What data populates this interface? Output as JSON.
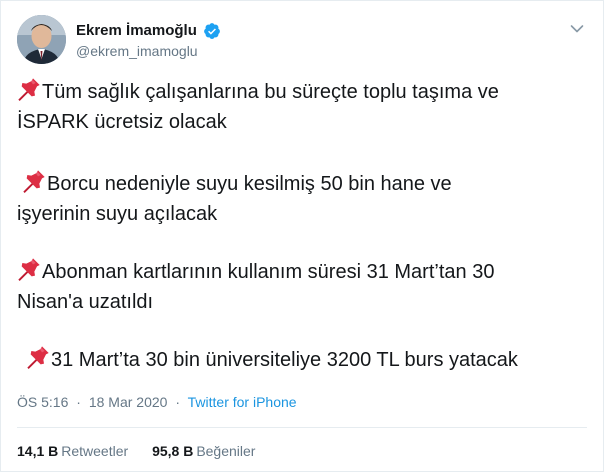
{
  "tweet": {
    "author": {
      "display_name": "Ekrem İmamoğlu",
      "handle": "@ekrem_imamoglu",
      "verified": true
    },
    "paragraphs": [
      {
        "line1": "Tüm sağlık çalışanlarına bu süreçte toplu taşıma ve",
        "line2": "İSPARK ücretsiz olacak"
      },
      {
        "line1": "Borcu nedeniyle suyu kesilmiş 50 bin hane ve",
        "line2": "işyerinin suyu açılacak"
      },
      {
        "line1": "Abonman kartlarının kullanım süresi 31 Mart’tan 30",
        "line2": "Nisan'a uzatıldı"
      },
      {
        "line1": "31 Mart’ta 30 bin üniversiteliye 3200 TL burs yatacak"
      }
    ],
    "meta": {
      "time": "ÖS 5:16",
      "separator": "·",
      "date": "18 Mar 2020",
      "source": "Twitter for iPhone"
    },
    "stats": {
      "retweets_count": "14,1 B",
      "retweets_label": "Retweetler",
      "likes_count": "95,8 B",
      "likes_label": "Beğeniler"
    }
  },
  "icons": {
    "pin": "pushpin-icon",
    "verified": "verified-badge-icon",
    "menu": "chevron-down-icon"
  },
  "colors": {
    "accent": "#1b95e0",
    "secondary_text": "#657786",
    "primary_text": "#14171a",
    "pin_red": "#dd2e44",
    "verified_blue": "#1da1f2"
  }
}
